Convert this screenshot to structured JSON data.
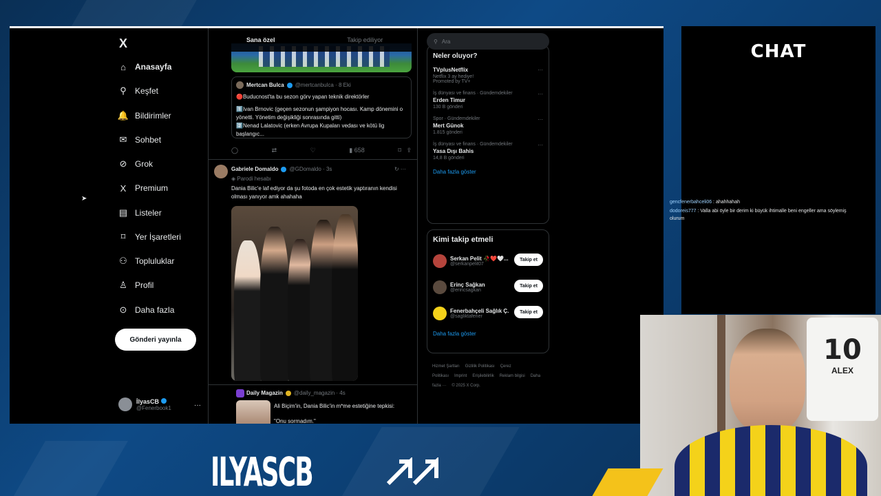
{
  "nav": {
    "logo": "X",
    "items": [
      {
        "label": "Anasayfa",
        "icon": "home-icon",
        "glyph": "⌂",
        "active": true
      },
      {
        "label": "Keşfet",
        "icon": "search-icon",
        "glyph": "⚲"
      },
      {
        "label": "Bildirimler",
        "icon": "bell-icon",
        "glyph": "🔔"
      },
      {
        "label": "Sohbet",
        "icon": "mail-icon",
        "glyph": "✉"
      },
      {
        "label": "Grok",
        "icon": "grok-icon",
        "glyph": "⊘"
      },
      {
        "label": "Premium",
        "icon": "x-premium-icon",
        "glyph": "X"
      },
      {
        "label": "Listeler",
        "icon": "list-icon",
        "glyph": "▤"
      },
      {
        "label": "Yer İşaretleri",
        "icon": "bookmark-icon",
        "glyph": "⌑"
      },
      {
        "label": "Topluluklar",
        "icon": "communities-icon",
        "glyph": "⚇"
      },
      {
        "label": "Profil",
        "icon": "profile-icon",
        "glyph": "♙"
      },
      {
        "label": "Daha fazla",
        "icon": "more-icon",
        "glyph": "⊙"
      }
    ],
    "post_button": "Gönderi yayınla",
    "profile": {
      "name": "İlyasCB",
      "handle": "@Fenerbook1",
      "dots": "···"
    }
  },
  "feed": {
    "tabs": [
      "Sana özel",
      "Takip ediliyor"
    ],
    "quote": {
      "name": "Mertcan Bulca",
      "handle": "@mertcanbulca · 8 Eki",
      "lines": [
        "🔴Buducnost'ta bu sezon görv yapan teknik direktörler",
        "1️⃣Ivan Brnovic (geçen sezonun şampiyon hocası. Kamp dönemini o yönetti. Yönetim değişikliği sonrasında gitti)",
        "2️⃣Nenad Lalatovic (erken Avrupa Kupaları vedası ve kötü lig başlangıc..."
      ]
    },
    "actions": {
      "reply": "◯",
      "retweet": "⇄",
      "like": "♡",
      "views": "658",
      "bookmark": "⌑",
      "share": "⇪"
    },
    "tweet2": {
      "name": "Gabriele Domaldo",
      "handle": "@GDomaldo · 3s",
      "parody": "Parodi hesabı",
      "text": "Dania Bilic'e laf ediyor da şu fotoda en çok estetik yaptıranın kendisi olması yanıyor amk ahahaha"
    },
    "tweet3": {
      "name": "Daily Magazin",
      "handle": "@daily_magazin · 4s",
      "line1": "Ali Biçim'in, Dania Bilic'in m*me estetiğine tepkisi:",
      "line2": "\"Onu sormadım.\""
    }
  },
  "right": {
    "search_placeholder": "Ara",
    "trends_title": "Neler oluyor?",
    "trends": [
      {
        "ctx": "",
        "name": "TVplusNetflix",
        "count": "Netflix 3 ay hediye!",
        "extra": "Promoted by TV+"
      },
      {
        "ctx": "İş dünyası ve finans · Gündemdekiler",
        "name": "Erden Timur",
        "count": "130 B gönderi"
      },
      {
        "ctx": "Spor · Gündemdekiler",
        "name": "Mert Günok",
        "count": "1.815 gönderi"
      },
      {
        "ctx": "İş dünyası ve finans · Gündemdekiler",
        "name": "Yasa Dışı Bahis",
        "count": "14,8 B gönderi"
      }
    ],
    "show_more": "Daha fazla göster",
    "who_title": "Kimi takip etmeli",
    "who": [
      {
        "name": "Serkan Pelit 🥀❤️🤍...",
        "handle": "@serkanpelit07",
        "color": "#b5443c"
      },
      {
        "name": "Erinç Sağkan",
        "handle": "@erincsagkan",
        "color": "#5a4a3e"
      },
      {
        "name": "Fenerbahçeli Sağlık Ç...",
        "handle": "@sagliktafener",
        "color": "#f4d21a"
      }
    ],
    "follow_label": "Takip et",
    "who_more": "Daha fazla göster",
    "footer": [
      "Hizmet Şartları",
      "Gizlilik Politikası",
      "Çerez Politikası",
      "Imprint",
      "Erişilebilirlik",
      "Reklam bilgisi",
      "Daha fazla ···",
      "© 2025 X Corp."
    ]
  },
  "chat": {
    "title": "CHAT",
    "messages": [
      {
        "user": "gencfenerbahceli06",
        "text": " : ahahhahah"
      },
      {
        "user": "dodoreis777",
        "text": " : Valla abi öyle bir derim ki büyük ihtimalle beni engeller ama söylemiş olurum"
      }
    ]
  },
  "cam": {
    "jersey_number": "10",
    "jersey_name": "ALEX"
  },
  "branding": {
    "name": "ILYASCB"
  }
}
